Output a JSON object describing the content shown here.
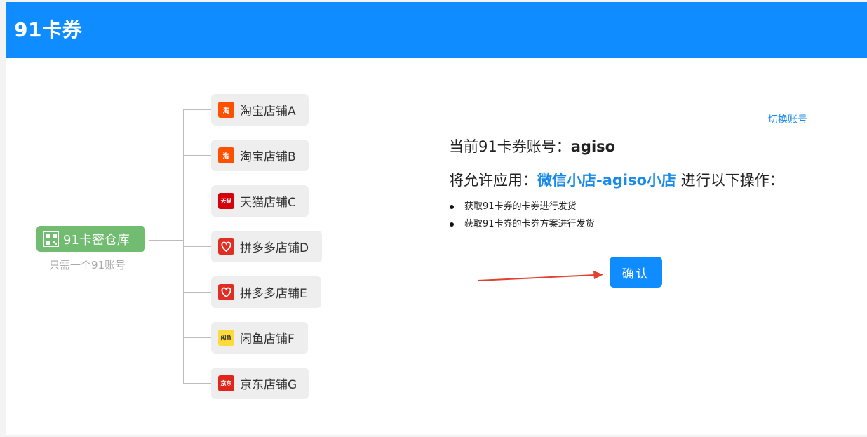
{
  "header": {
    "title": "91卡券"
  },
  "diagram": {
    "center_label": "91卡密仓库",
    "center_sub": "只需一个91账号",
    "stores": [
      {
        "label": "淘宝店铺A",
        "logo_text": "淘",
        "logo_color": "#ff5000"
      },
      {
        "label": "淘宝店铺B",
        "logo_text": "淘",
        "logo_color": "#ff5000"
      },
      {
        "label": "天猫店铺C",
        "logo_text": "天猫",
        "logo_color": "#d4000c"
      },
      {
        "label": "拼多多店铺D",
        "logo_text": "",
        "logo_color": "#e02e24"
      },
      {
        "label": "拼多多店铺E",
        "logo_text": "",
        "logo_color": "#e02e24"
      },
      {
        "label": "闲鱼店铺F",
        "logo_text": "闲鱼",
        "logo_color": "#ffda3b"
      },
      {
        "label": "京东店铺G",
        "logo_text": "京东",
        "logo_color": "#e1251b"
      }
    ]
  },
  "panel": {
    "switch_account": "切换账号",
    "account_prefix": "当前91卡券账号：",
    "account_name": "agiso",
    "permit_prefix": "将允许应用：",
    "app_name": "微信小店-agiso小店",
    "permit_suffix": " 进行以下操作：",
    "operations": [
      "获取91卡券的卡券进行发货",
      "获取91卡券的卡券方案进行发货"
    ],
    "confirm_label": "确认"
  },
  "colors": {
    "primary": "#0f8cff",
    "link": "#1a8ae8",
    "green_node": "#71bc70",
    "arrow": "#e0432f"
  }
}
